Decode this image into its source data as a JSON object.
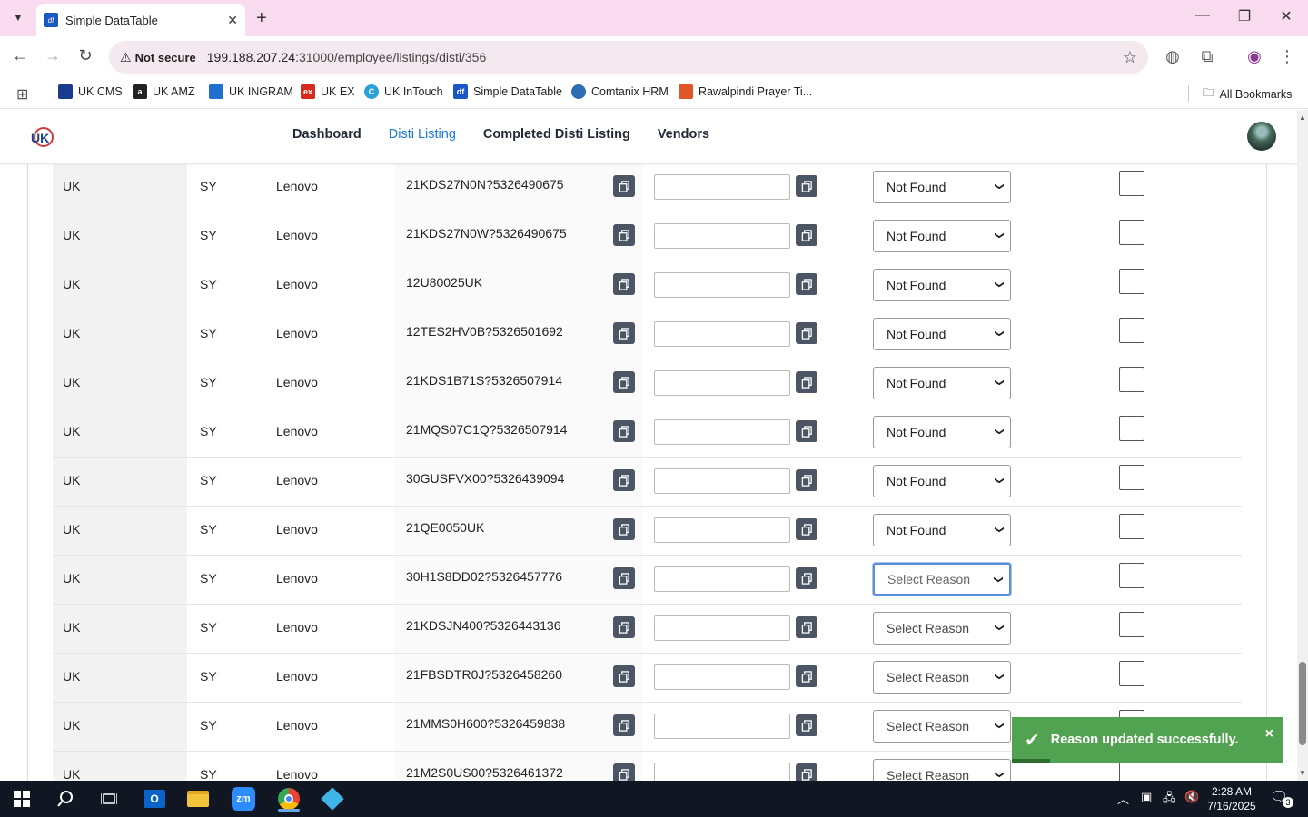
{
  "browser": {
    "tab_title": "Simple DataTable",
    "tab_favicon_text": "df",
    "not_secure": "Not secure",
    "url_host": "199.188.207.24",
    "url_rest": ":31000/employee/listings/disti/356",
    "bookmarks": [
      {
        "label": "UK CMS",
        "color": "#1a3a8f",
        "icon_text": ""
      },
      {
        "label": "UK AMZ",
        "color": "#222222",
        "icon_text": "a"
      },
      {
        "label": "UK INGRAM",
        "color": "#1f6fd1",
        "icon_text": ""
      },
      {
        "label": "UK EX",
        "color": "#d62a1e",
        "icon_text": "ex"
      },
      {
        "label": "UK InTouch",
        "color": "#2a9fd8",
        "icon_text": "C"
      },
      {
        "label": "Simple DataTable",
        "color": "#1a56c4",
        "icon_text": "df"
      },
      {
        "label": "Comtanix HRM",
        "color": "#2d6db5",
        "icon_text": ""
      },
      {
        "label": "Rawalpindi Prayer Ti...",
        "color": "#e0552a",
        "icon_text": ""
      }
    ],
    "all_bookmarks": "All Bookmarks"
  },
  "site": {
    "nav": [
      {
        "label": "Dashboard",
        "active": false
      },
      {
        "label": "Disti Listing",
        "active": true
      },
      {
        "label": "Completed Disti Listing",
        "active": false
      },
      {
        "label": "Vendors",
        "active": false
      }
    ]
  },
  "rows": [
    {
      "country": "UK",
      "code": "SY",
      "vendor": "Lenovo",
      "part": "21KDS27N0N?5326490675",
      "reason": "Not Found"
    },
    {
      "country": "UK",
      "code": "SY",
      "vendor": "Lenovo",
      "part": "21KDS27N0W?5326490675",
      "reason": "Not Found"
    },
    {
      "country": "UK",
      "code": "SY",
      "vendor": "Lenovo",
      "part": "12U80025UK",
      "reason": "Not Found"
    },
    {
      "country": "UK",
      "code": "SY",
      "vendor": "Lenovo",
      "part": "12TES2HV0B?5326501692",
      "reason": "Not Found"
    },
    {
      "country": "UK",
      "code": "SY",
      "vendor": "Lenovo",
      "part": "21KDS1B71S?5326507914",
      "reason": "Not Found"
    },
    {
      "country": "UK",
      "code": "SY",
      "vendor": "Lenovo",
      "part": "21MQS07C1Q?5326507914",
      "reason": "Not Found"
    },
    {
      "country": "UK",
      "code": "SY",
      "vendor": "Lenovo",
      "part": "30GUSFVX00?5326439094",
      "reason": "Not Found"
    },
    {
      "country": "UK",
      "code": "SY",
      "vendor": "Lenovo",
      "part": "21QE0050UK",
      "reason": "Not Found"
    },
    {
      "country": "UK",
      "code": "SY",
      "vendor": "Lenovo",
      "part": "30H1S8DD02?5326457776",
      "reason": "Select Reason",
      "focused": true
    },
    {
      "country": "UK",
      "code": "SY",
      "vendor": "Lenovo",
      "part": "21KDSJN400?5326443136",
      "reason": "Select Reason"
    },
    {
      "country": "UK",
      "code": "SY",
      "vendor": "Lenovo",
      "part": "21FBSDTR0J?5326458260",
      "reason": "Select Reason"
    },
    {
      "country": "UK",
      "code": "SY",
      "vendor": "Lenovo",
      "part": "21MMS0H600?5326459838",
      "reason": "Select Reason"
    },
    {
      "country": "UK",
      "code": "SY",
      "vendor": "Lenovo",
      "part": "21M2S0US00?5326461372",
      "reason": "Select Reason"
    }
  ],
  "toast": {
    "message": "Reason updated successfully.",
    "close": "×",
    "color": "#51a351"
  },
  "taskbar": {
    "time": "2:28 AM",
    "date": "7/16/2025",
    "notifications": "3"
  },
  "colors": {
    "tabstrip": "#f9dcef",
    "nav_active": "#1e78d4",
    "copy_button": "#4b5563"
  }
}
